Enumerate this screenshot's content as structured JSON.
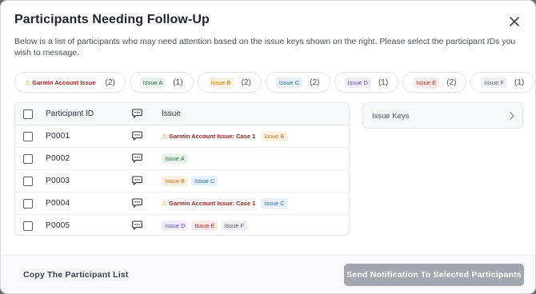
{
  "modal": {
    "title": "Participants Needing Follow-Up",
    "description": "Below is a list of participants who may need attention based on the issue keys shown on the right. Please select the participant IDs you wish to message."
  },
  "filter_chips": [
    {
      "label": "Garmin Account Issue",
      "count": "(2)",
      "style": "warn",
      "icon": "warning-icon"
    },
    {
      "label": "Issue A",
      "count": "(1)",
      "style": "a"
    },
    {
      "label": "Issue B",
      "count": "(2)",
      "style": "b"
    },
    {
      "label": "Issue C",
      "count": "(2)",
      "style": "c"
    },
    {
      "label": "Issue D",
      "count": "(1)",
      "style": "d"
    },
    {
      "label": "Issue E",
      "count": "(2)",
      "style": "e"
    },
    {
      "label": "Issue F",
      "count": "(1)",
      "style": "f"
    }
  ],
  "table": {
    "headers": {
      "participant_id": "Participant ID",
      "issue": "Issue",
      "message_icon": "message-icon"
    },
    "rows": [
      {
        "id": "P0001",
        "issues": [
          {
            "label": "Garmin Account Issue: Case 1",
            "style": "warn"
          },
          {
            "label": "Issue B",
            "style": "b"
          }
        ]
      },
      {
        "id": "P0002",
        "issues": [
          {
            "label": "Issue A",
            "style": "a"
          }
        ]
      },
      {
        "id": "P0003",
        "issues": [
          {
            "label": "Issue B",
            "style": "b"
          },
          {
            "label": "Issue C",
            "style": "c"
          }
        ]
      },
      {
        "id": "P0004",
        "issues": [
          {
            "label": "Garmin Account Issue: Case 1",
            "style": "warn"
          },
          {
            "label": "Issue C",
            "style": "c"
          }
        ]
      },
      {
        "id": "P0005",
        "issues": [
          {
            "label": "Issue D",
            "style": "d"
          },
          {
            "label": "Issue E",
            "style": "e"
          },
          {
            "label": "Issue F",
            "style": "f"
          }
        ]
      }
    ]
  },
  "side_panel": {
    "label": "Issue Keys",
    "icon": "chevron-right-icon"
  },
  "footer": {
    "copy_label": "Copy The Participant List",
    "send_label": "Send Notification To Selected Participants"
  },
  "colors": {
    "send_button_disabled": "#a3a6b0",
    "warning": "#e0a31a",
    "warn_text": "#a3201b"
  }
}
